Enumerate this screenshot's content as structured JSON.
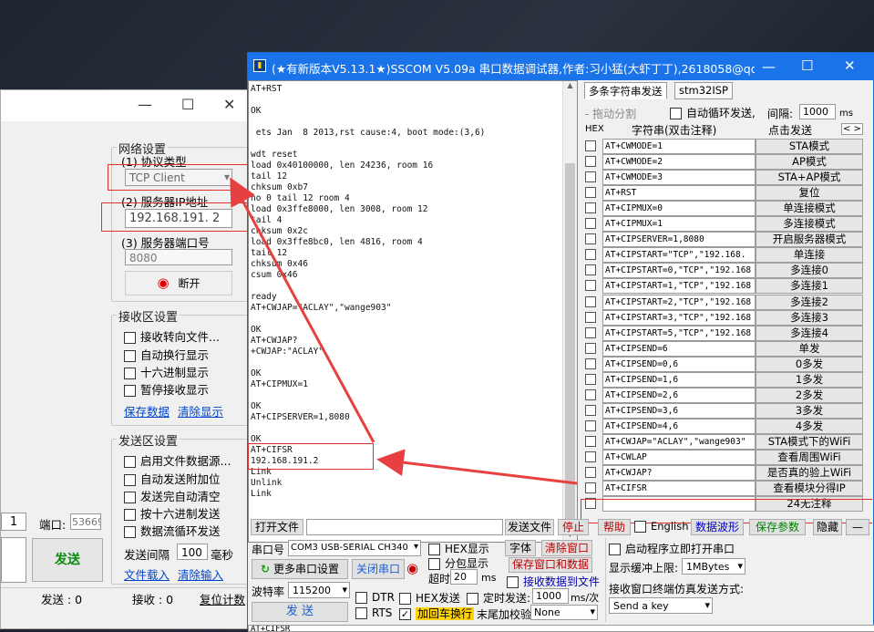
{
  "left_window": {
    "controls": {
      "minimize": "—",
      "maximize": "☐",
      "close": "✕"
    },
    "network": {
      "title": "网络设置",
      "protocol_label": "(1) 协议类型",
      "protocol_value": "TCP Client",
      "ip_label": "(2) 服务器IP地址",
      "ip_value": "192.168.191. 2",
      "port_label": "(3) 服务器端口号",
      "port_value": "8080",
      "disconnect_label": "断开"
    },
    "receive": {
      "title": "接收区设置",
      "options": [
        "接收转向文件...",
        "自动换行显示",
        "十六进制显示",
        "暂停接收显示"
      ],
      "save_label": "保存数据",
      "clear_label": "清除显示"
    },
    "send": {
      "title": "发送区设置",
      "options": [
        "启用文件数据源...",
        "自动发送附加位",
        "发送完自动清空",
        "按十六进制发送",
        "数据流循环发送"
      ],
      "interval_label": "发送间隔",
      "interval_value": "100",
      "interval_unit": "毫秒",
      "file_load": "文件载入",
      "clear_input": "清除输入"
    },
    "bottom": {
      "count_value": "1",
      "port_label": "端口:",
      "port_value": "53669",
      "send_button": "发送",
      "send_count": "发送 : 0",
      "recv_count": "接收 : 0",
      "reset_count": "复位计数"
    }
  },
  "sscom": {
    "title": "(★有新版本V5.13.1★)SSCOM V5.09a 串口数据调试器,作者:习小猛(大虾丁丁),2618058@qq.c...",
    "controls": {
      "minimize": "—",
      "maximize": "☐",
      "close": "✕"
    },
    "terminal_text": "AT+RST\n\nOK\n\n ets Jan  8 2013,rst cause:4, boot mode:(3,6)\n\nwdt reset\nload 0x40100000, len 24236, room 16\ntail 12\nchksum 0xb7\nho 0 tail 12 room 4\nload 0x3ffe8000, len 3008, room 12\ntail 4\nchksum 0x2c\nload 0x3ffe8bc0, len 4816, room 4\ntail 12\nchksum 0x46\ncsum 0x46\n\nready\nAT+CWJAP=\"ACLAY\",\"wange903\"\n\nOK\nAT+CWJAP?\n+CWJAP:\"ACLAY\"\n\nOK\nAT+CIPMUX=1\n\nOK\nAT+CIPSERVER=1,8080\n\nOK\nAT+CIFSR\n192.168.191.2\nLink\nUnlink\nLink",
    "tabs": [
      "多条字符串发送",
      "stm32ISP"
    ],
    "drag_label": "拖动分割",
    "loop_label": "自动循环发送,",
    "interval_label": "间隔:",
    "interval_value": "1000",
    "interval_unit": "ms",
    "col_hex": "HEX",
    "col_string": "字符串(双击注释)",
    "col_send": "点击发送",
    "commands": [
      {
        "cmd": "AT+CWMODE=1",
        "label": "STA模式"
      },
      {
        "cmd": "AT+CWMODE=2",
        "label": "AP模式"
      },
      {
        "cmd": "AT+CWMODE=3",
        "label": "STA+AP模式"
      },
      {
        "cmd": "AT+RST",
        "label": "复位"
      },
      {
        "cmd": "AT+CIPMUX=0",
        "label": "单连接模式"
      },
      {
        "cmd": "AT+CIPMUX=1",
        "label": "多连接模式"
      },
      {
        "cmd": "AT+CIPSERVER=1,8080",
        "label": "开启服务器模式"
      },
      {
        "cmd": "AT+CIPSTART=\"TCP\",\"192.168.",
        "label": "单连接"
      },
      {
        "cmd": "AT+CIPSTART=0,\"TCP\",\"192.168",
        "label": "多连接0"
      },
      {
        "cmd": "AT+CIPSTART=1,\"TCP\",\"192.168",
        "label": "多连接1"
      },
      {
        "cmd": "AT+CIPSTART=2,\"TCP\",\"192.168",
        "label": "多连接2"
      },
      {
        "cmd": "AT+CIPSTART=3,\"TCP\",\"192.168",
        "label": "多连接3"
      },
      {
        "cmd": "AT+CIPSTART=5,\"TCP\",\"192.168",
        "label": "多连接4"
      },
      {
        "cmd": "AT+CIPSEND=6",
        "label": "单发"
      },
      {
        "cmd": "AT+CIPSEND=0,6",
        "label": "0多发"
      },
      {
        "cmd": "AT+CIPSEND=1,6",
        "label": "1多发"
      },
      {
        "cmd": "AT+CIPSEND=2,6",
        "label": "2多发"
      },
      {
        "cmd": "AT+CIPSEND=3,6",
        "label": "3多发"
      },
      {
        "cmd": "AT+CIPSEND=4,6",
        "label": "4多发"
      },
      {
        "cmd": "AT+CWJAP=\"ACLAY\",\"wange903\"",
        "label": "STA模式下的WiFi"
      },
      {
        "cmd": "AT+CWLAP",
        "label": "查看周围WiFi"
      },
      {
        "cmd": "AT+CWJAP?",
        "label": "是否真的验上WiFi"
      },
      {
        "cmd": "AT+CIFSR",
        "label": "查看模块分得IP"
      },
      {
        "cmd": "",
        "label": "24无注释"
      }
    ],
    "toolbar": {
      "open_file": "打开文件",
      "send_file": "发送文件",
      "stop": "停止",
      "help": "帮助",
      "english": "English",
      "waveform": "数据波形",
      "save_params": "保存参数",
      "hide": "隐藏",
      "dash": "—"
    },
    "bottom": {
      "port_label": "串口号",
      "port_value": "COM3 USB-SERIAL CH340",
      "more_settings": "更多串口设置",
      "close_port": "关闭串口",
      "baud_label": "波特率",
      "baud_value": "115200",
      "send": "发  送",
      "hex_display": "HEX显示",
      "split_display": "分包显示",
      "font": "字体",
      "clear_window": "清除窗口",
      "save_window": "保存窗口和数据",
      "timeout_label": "超时",
      "timeout_value": "20",
      "timeout_unit": "ms",
      "recv_to_file": "接收数据到文件",
      "dtr": "DTR",
      "rts": "RTS",
      "hex_send": "HEX发送",
      "timed_send": "定时发送:",
      "timed_value": "1000",
      "timed_unit": "ms/次",
      "add_crlf": "加回车换行",
      "tail_check": "末尾加校验",
      "check_value": "None",
      "auto_open": "启动程序立即打开串口",
      "buffer_label": "显示缓冲上限:",
      "buffer_value": "1MBytes",
      "emul_label": "接收窗口终端仿真发送方式:",
      "emul_value": "Send a key",
      "input_text": "AT+CIFSR"
    }
  }
}
